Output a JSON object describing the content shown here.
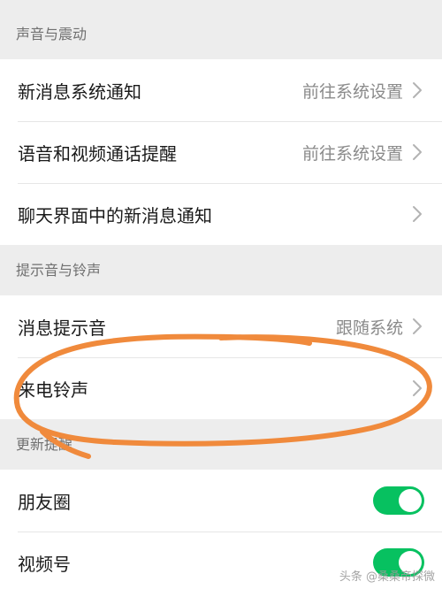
{
  "sections": {
    "sound_vibration": {
      "title": "声音与震动"
    },
    "tones": {
      "title": "提示音与铃声"
    },
    "updates": {
      "title": "更新提醒"
    }
  },
  "rows": {
    "new_message_system": {
      "label": "新消息系统通知",
      "value": "前往系统设置"
    },
    "voice_video_call": {
      "label": "语音和视频通话提醒",
      "value": "前往系统设置"
    },
    "in_chat_notification": {
      "label": "聊天界面中的新消息通知"
    },
    "message_tone": {
      "label": "消息提示音",
      "value": "跟随系统"
    },
    "ringtone": {
      "label": "来电铃声"
    },
    "moments": {
      "label": "朋友圈",
      "toggle_on": true
    },
    "channels": {
      "label": "视频号",
      "toggle_on": true
    }
  },
  "watermark": {
    "text": "头条 @桑桑帝探微"
  },
  "colors": {
    "toggle_on": "#07c160",
    "annotation_stroke": "#f08a3c",
    "background": "#ededed"
  },
  "icons": {
    "chevron": "chevron-right-icon",
    "toggle": "toggle-switch"
  }
}
